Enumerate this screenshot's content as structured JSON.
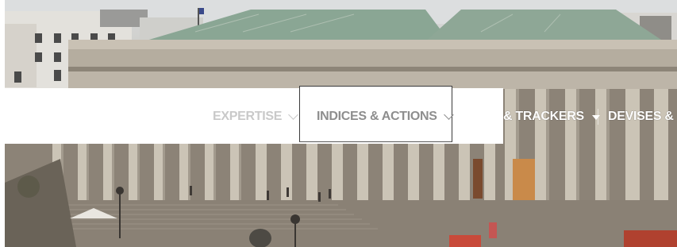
{
  "nav": {
    "items": [
      {
        "label": "EXPERTISE",
        "icon": "chevron-down-icon"
      },
      {
        "label": "INDICES & ACTIONS",
        "icon": "chevron-down-icon",
        "active": true
      },
      {
        "label": "& TRACKERS",
        "icon": "caret-down-icon"
      },
      {
        "label": "DEVISES & M"
      }
    ]
  },
  "colors": {
    "nav_inactive": "#c9c9c9",
    "nav_active": "#8e8e8e",
    "nav_on_photo": "#ffffff",
    "stone": "#b9b1a3",
    "roof": "#7f9a86"
  }
}
